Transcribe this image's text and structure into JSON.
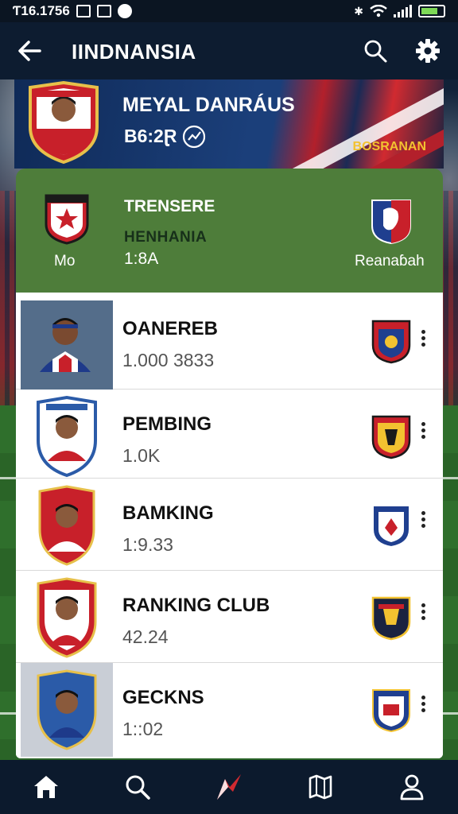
{
  "status_bar": {
    "time": "Ƭ16.1756"
  },
  "app_bar": {
    "title": "IINDNANSIA"
  },
  "player_banner": {
    "name": "MEYAL DANRÁUS",
    "value": "B6:2Ɽ",
    "club": "BOSRANAN",
    "colors": {
      "navy": "#1b3f7a",
      "red": "#d12a30",
      "gold": "#f2c230"
    }
  },
  "transfer_card": {
    "title": "TRENSERE",
    "subtitle": "HENHANIA",
    "fee": "1:8A",
    "from_label": "Mo",
    "to_label": "Reanaɓah",
    "color": "#4e7d3a"
  },
  "players": [
    {
      "name": "OANEREB",
      "value": "1.000 3833"
    },
    {
      "name": "PEMBING",
      "value": "1.0K"
    },
    {
      "name": "BAMKING",
      "value": "1:9.33"
    },
    {
      "name": "RANKING CLUB",
      "value": "42.24"
    },
    {
      "name": "GECKNS",
      "value": "1::02"
    }
  ],
  "bottom_nav": {
    "items": [
      "home-icon",
      "search-icon",
      "transfer-icon",
      "map-icon",
      "profile-icon"
    ],
    "active": "home-icon"
  }
}
